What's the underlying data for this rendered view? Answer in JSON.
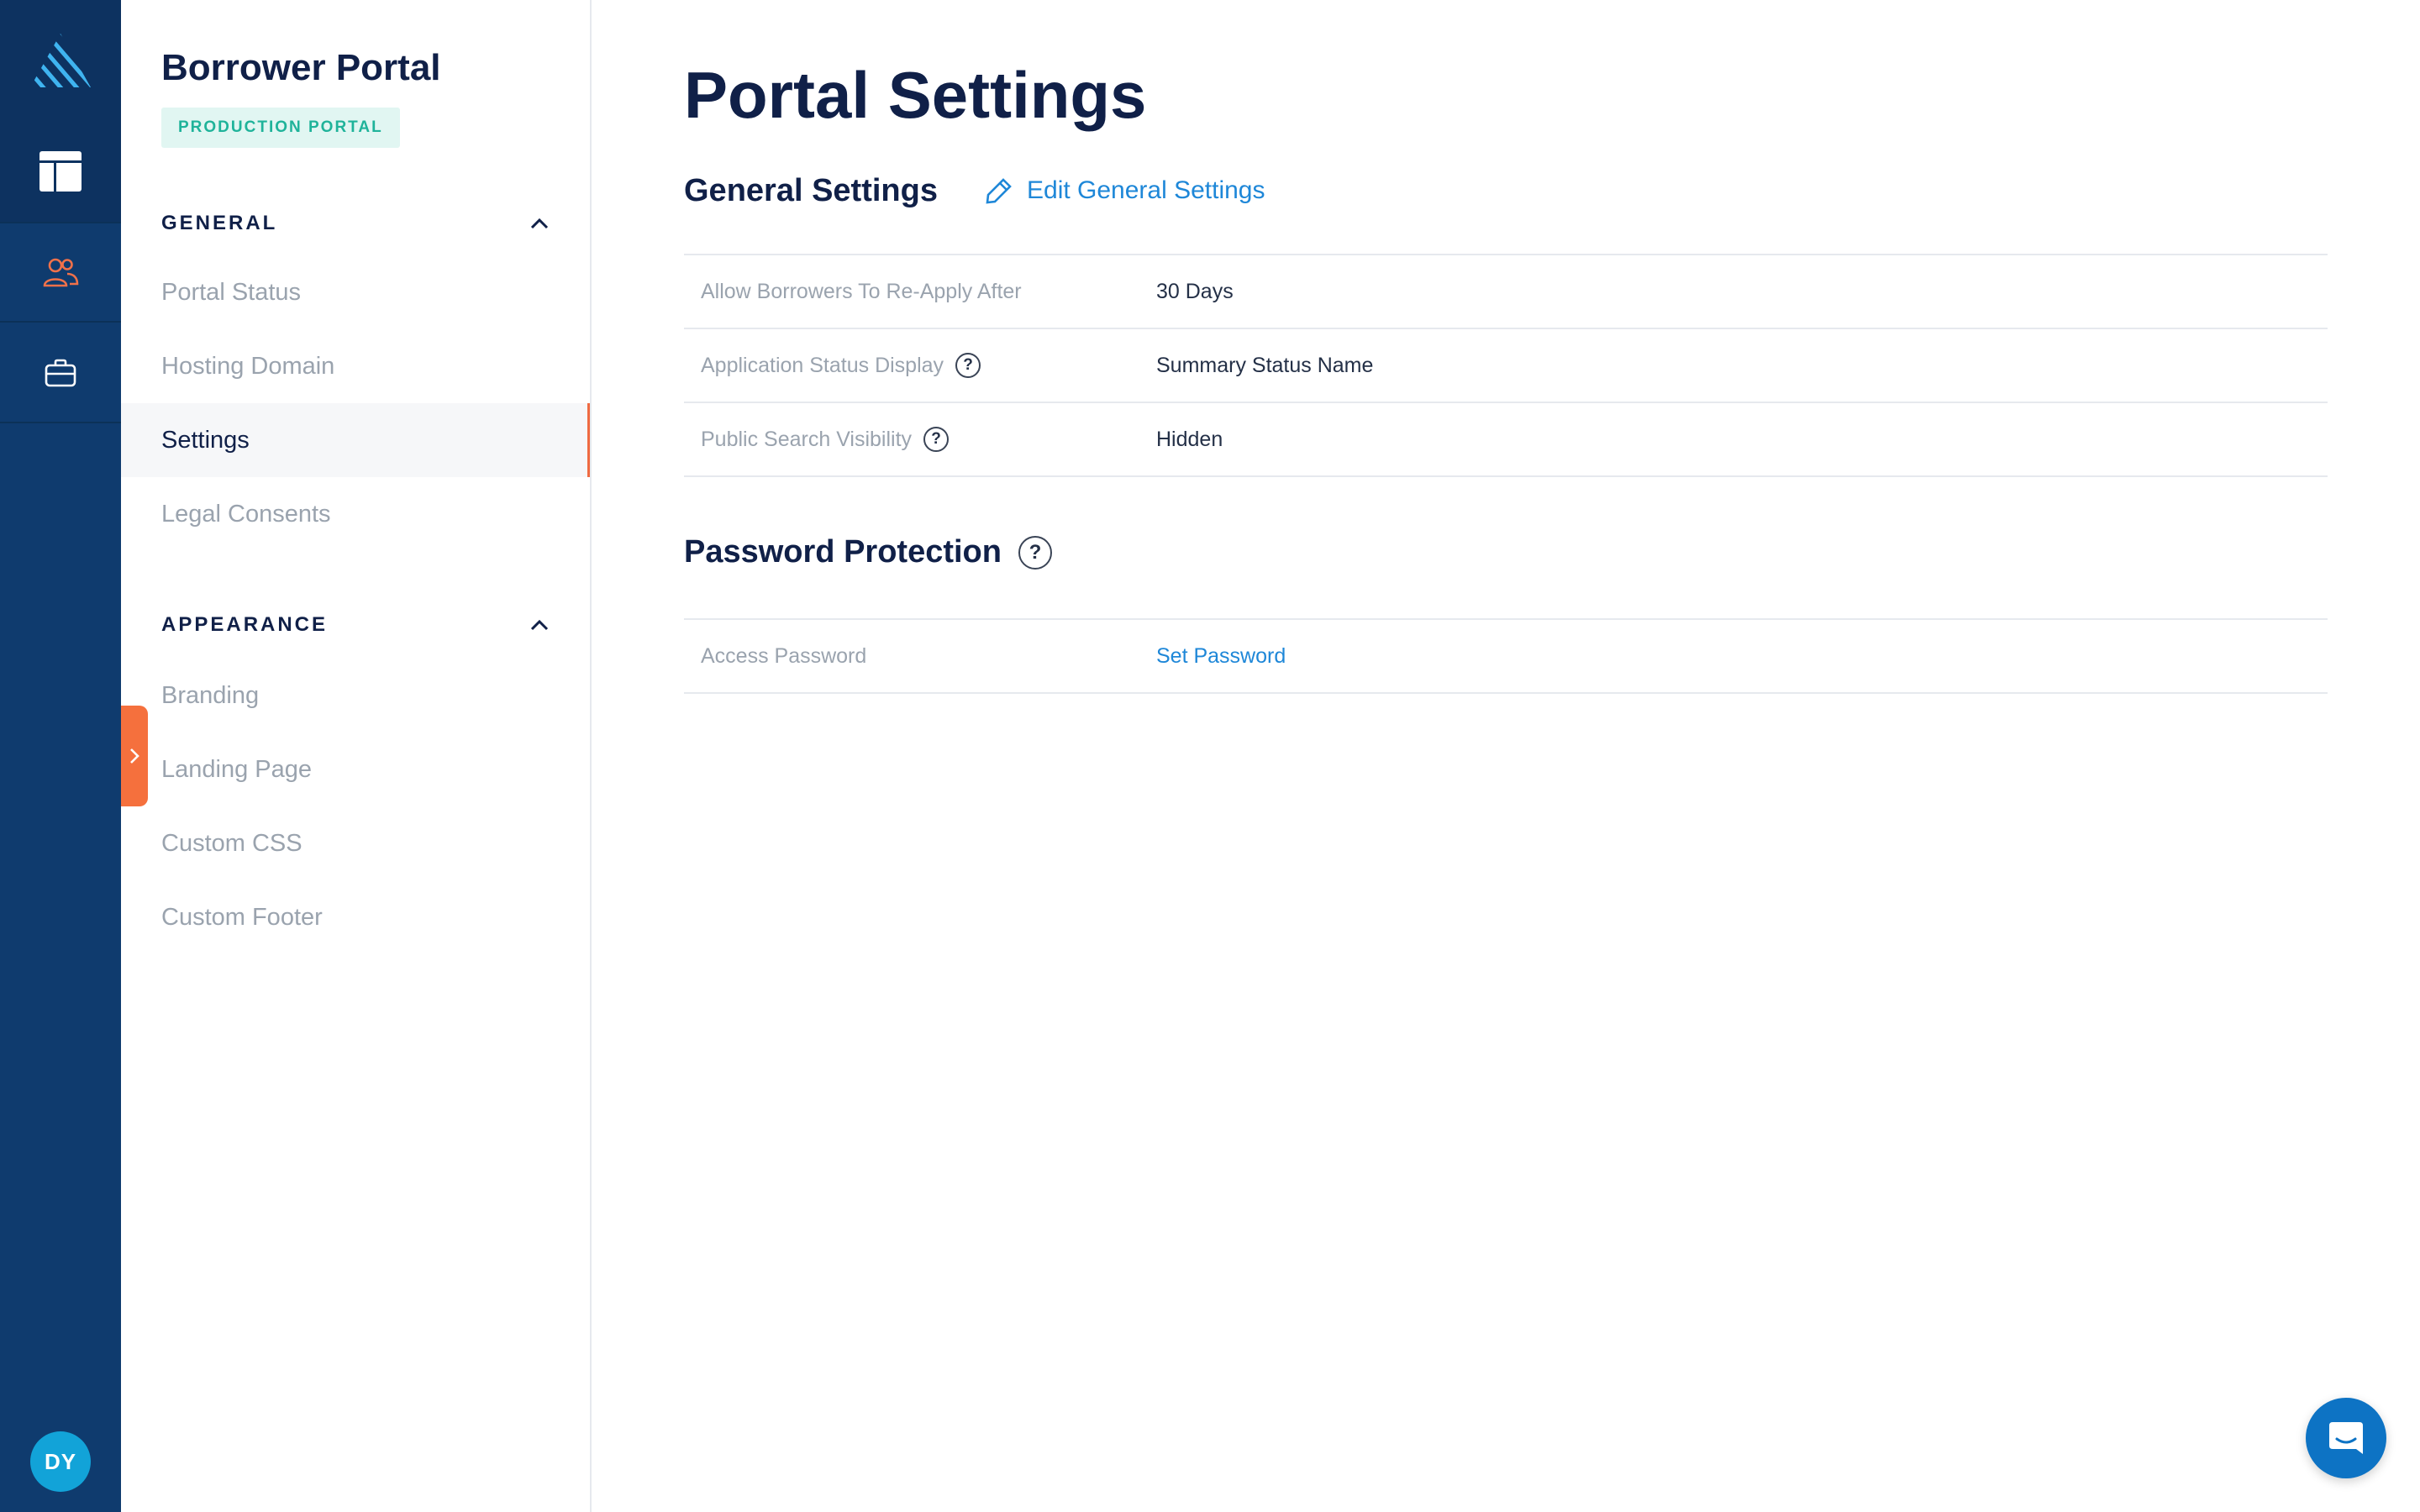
{
  "rail": {
    "icons": [
      "logo-icon",
      "dashboard-icon",
      "people-icon",
      "briefcase-icon"
    ],
    "avatar_initials": "DY"
  },
  "sidebar": {
    "title": "Borrower Portal",
    "badge": "PRODUCTION PORTAL",
    "sections": [
      {
        "heading": "GENERAL",
        "items": [
          {
            "label": "Portal Status"
          },
          {
            "label": "Hosting Domain"
          },
          {
            "label": "Settings",
            "active": true
          },
          {
            "label": "Legal Consents"
          }
        ]
      },
      {
        "heading": "APPEARANCE",
        "items": [
          {
            "label": "Branding"
          },
          {
            "label": "Landing Page"
          },
          {
            "label": "Custom CSS"
          },
          {
            "label": "Custom Footer"
          }
        ]
      }
    ]
  },
  "main": {
    "title": "Portal Settings",
    "general": {
      "heading": "General Settings",
      "edit_label": "Edit General Settings",
      "rows": [
        {
          "label": "Allow Borrowers To Re-Apply After",
          "value": "30 Days"
        },
        {
          "label": "Application Status Display",
          "value": "Summary Status Name"
        },
        {
          "label": "Public Search Visibility",
          "value": "Hidden"
        }
      ]
    },
    "password": {
      "heading": "Password Protection",
      "rows": [
        {
          "label": "Access Password",
          "value": "Set Password"
        }
      ]
    }
  },
  "help_glyph": "?",
  "colors": {
    "rail_bg": "#0f3b6e",
    "accent_orange": "#f5703d",
    "link_blue": "#1e87d8",
    "badge_green": "#1fb39a",
    "title_navy": "#102048"
  }
}
